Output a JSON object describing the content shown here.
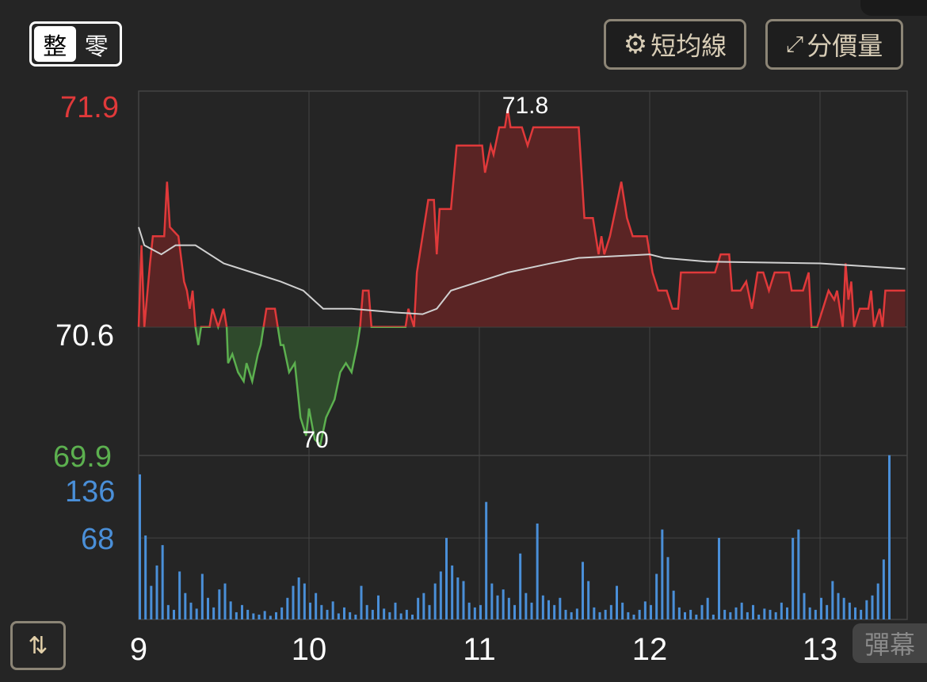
{
  "toolbar": {
    "board_lot": "整",
    "odd_lot": "零",
    "ma_button": "短均線",
    "price_volume_button": "分價量",
    "danmaku_button": "彈幕"
  },
  "colors": {
    "up": "#e0393a",
    "down": "#5cb04f",
    "volume": "#4a8fd8",
    "avg": "#d0d0d0",
    "grid": "#444444"
  },
  "chart_data": {
    "type": "line",
    "title": "",
    "price_axis": {
      "max_label": "71.9",
      "ref_label": "70.6",
      "min_label": "69.9",
      "ylim": [
        69.9,
        71.9
      ],
      "reference": 70.6
    },
    "volume_axis": {
      "labels": [
        "136",
        "68"
      ],
      "ylim": [
        0,
        150
      ]
    },
    "xticks": [
      "9",
      "10",
      "11",
      "12",
      "13"
    ],
    "x_minutes_range": [
      0,
      270
    ],
    "annotations": {
      "high": "71.8",
      "low": "70"
    },
    "price": [
      [
        0,
        70.6
      ],
      [
        1,
        71.05
      ],
      [
        2,
        70.6
      ],
      [
        4,
        70.95
      ],
      [
        5,
        71.1
      ],
      [
        9,
        71.1
      ],
      [
        10,
        71.4
      ],
      [
        11,
        71.15
      ],
      [
        14,
        71.1
      ],
      [
        16,
        70.85
      ],
      [
        17,
        70.8
      ],
      [
        18,
        70.7
      ],
      [
        19,
        70.8
      ],
      [
        20,
        70.6
      ],
      [
        21,
        70.5
      ],
      [
        22,
        70.6
      ],
      [
        25,
        70.6
      ],
      [
        26,
        70.7
      ],
      [
        28,
        70.6
      ],
      [
        30,
        70.7
      ],
      [
        31,
        70.6
      ],
      [
        31.5,
        70.4
      ],
      [
        33,
        70.45
      ],
      [
        35,
        70.35
      ],
      [
        37,
        70.3
      ],
      [
        38,
        70.4
      ],
      [
        40,
        70.3
      ],
      [
        42,
        70.45
      ],
      [
        43,
        70.5
      ],
      [
        44,
        70.6
      ],
      [
        45,
        70.7
      ],
      [
        48,
        70.7
      ],
      [
        49,
        70.6
      ],
      [
        50,
        70.5
      ],
      [
        51,
        70.5
      ],
      [
        53,
        70.35
      ],
      [
        55,
        70.4
      ],
      [
        57,
        70.1
      ],
      [
        59,
        70.0
      ],
      [
        60,
        70.15
      ],
      [
        62,
        69.98
      ],
      [
        64,
        69.95
      ],
      [
        66,
        70.1
      ],
      [
        69,
        70.2
      ],
      [
        71,
        70.35
      ],
      [
        73,
        70.4
      ],
      [
        75,
        70.35
      ],
      [
        77,
        70.5
      ],
      [
        78,
        70.6
      ],
      [
        79,
        70.8
      ],
      [
        81,
        70.8
      ],
      [
        82,
        70.6
      ],
      [
        94,
        70.6
      ],
      [
        95,
        70.7
      ],
      [
        97,
        70.6
      ],
      [
        98,
        70.9
      ],
      [
        100,
        71.1
      ],
      [
        102,
        71.3
      ],
      [
        104,
        71.3
      ],
      [
        105,
        71.0
      ],
      [
        106,
        71.25
      ],
      [
        110,
        71.25
      ],
      [
        112,
        71.6
      ],
      [
        121,
        71.6
      ],
      [
        122,
        71.45
      ],
      [
        124,
        71.6
      ],
      [
        125,
        71.55
      ],
      [
        127,
        71.7
      ],
      [
        129,
        71.7
      ],
      [
        130,
        71.8
      ],
      [
        131,
        71.7
      ],
      [
        135,
        71.7
      ],
      [
        137,
        71.6
      ],
      [
        139,
        71.7
      ],
      [
        155,
        71.7
      ],
      [
        157,
        71.2
      ],
      [
        160,
        71.2
      ],
      [
        162,
        71.0
      ],
      [
        163,
        71.1
      ],
      [
        164,
        71.0
      ],
      [
        166,
        71.1
      ],
      [
        168,
        71.25
      ],
      [
        170,
        71.4
      ],
      [
        172,
        71.2
      ],
      [
        174,
        71.1
      ],
      [
        179,
        71.1
      ],
      [
        181,
        70.9
      ],
      [
        183,
        70.8
      ],
      [
        186,
        70.8
      ],
      [
        188,
        70.7
      ],
      [
        190,
        70.7
      ],
      [
        191,
        70.9
      ],
      [
        203,
        70.9
      ],
      [
        205,
        71.0
      ],
      [
        208,
        71.0
      ],
      [
        209,
        70.8
      ],
      [
        212,
        70.8
      ],
      [
        214,
        70.85
      ],
      [
        216,
        70.7
      ],
      [
        218,
        70.9
      ],
      [
        220,
        70.9
      ],
      [
        222,
        70.8
      ],
      [
        224,
        70.9
      ],
      [
        229,
        70.9
      ],
      [
        230,
        70.8
      ],
      [
        234,
        70.8
      ],
      [
        236,
        70.9
      ],
      [
        237,
        70.6
      ],
      [
        239,
        70.6
      ],
      [
        241,
        70.7
      ],
      [
        243,
        70.8
      ],
      [
        245,
        70.75
      ],
      [
        246,
        70.8
      ],
      [
        248,
        70.6
      ],
      [
        249,
        70.95
      ],
      [
        250,
        70.75
      ],
      [
        251,
        70.85
      ],
      [
        252,
        70.6
      ],
      [
        254,
        70.7
      ],
      [
        257,
        70.7
      ],
      [
        258,
        70.8
      ],
      [
        259,
        70.6
      ],
      [
        261,
        70.7
      ],
      [
        262,
        70.6
      ],
      [
        263,
        70.8
      ],
      [
        270,
        70.8
      ]
    ],
    "average": [
      [
        0,
        71.15
      ],
      [
        2,
        71.05
      ],
      [
        8,
        71.0
      ],
      [
        13,
        71.05
      ],
      [
        20,
        71.05
      ],
      [
        30,
        70.95
      ],
      [
        40,
        70.9
      ],
      [
        50,
        70.85
      ],
      [
        58,
        70.8
      ],
      [
        65,
        70.7
      ],
      [
        75,
        70.7
      ],
      [
        90,
        70.68
      ],
      [
        100,
        70.67
      ],
      [
        105,
        70.7
      ],
      [
        110,
        70.8
      ],
      [
        120,
        70.85
      ],
      [
        130,
        70.9
      ],
      [
        145,
        70.95
      ],
      [
        155,
        70.98
      ],
      [
        180,
        71.0
      ],
      [
        185,
        70.98
      ],
      [
        200,
        70.96
      ],
      [
        240,
        70.95
      ],
      [
        270,
        70.92
      ]
    ],
    "volume_interval_minutes": 2,
    "volume": [
      121,
      70,
      28,
      45,
      62,
      12,
      8,
      40,
      22,
      14,
      9,
      38,
      18,
      10,
      25,
      30,
      15,
      6,
      12,
      8,
      5,
      4,
      7,
      3,
      6,
      10,
      18,
      28,
      35,
      30,
      14,
      22,
      12,
      8,
      15,
      5,
      10,
      6,
      4,
      28,
      12,
      8,
      20,
      9,
      6,
      14,
      5,
      8,
      4,
      18,
      22,
      12,
      30,
      40,
      68,
      45,
      35,
      32,
      14,
      10,
      12,
      98,
      30,
      20,
      25,
      18,
      12,
      55,
      22,
      14,
      80,
      20,
      16,
      12,
      18,
      8,
      6,
      9,
      48,
      32,
      10,
      6,
      8,
      12,
      28,
      14,
      6,
      4,
      8,
      15,
      12,
      38,
      75,
      52,
      24,
      10,
      6,
      8,
      4,
      12,
      18,
      4,
      68,
      8,
      6,
      10,
      14,
      6,
      12,
      4,
      9,
      8,
      6,
      14,
      10,
      68,
      75,
      22,
      10,
      8,
      18,
      12,
      32,
      22,
      18,
      14,
      10,
      8,
      16,
      20,
      30,
      50,
      137
    ]
  }
}
